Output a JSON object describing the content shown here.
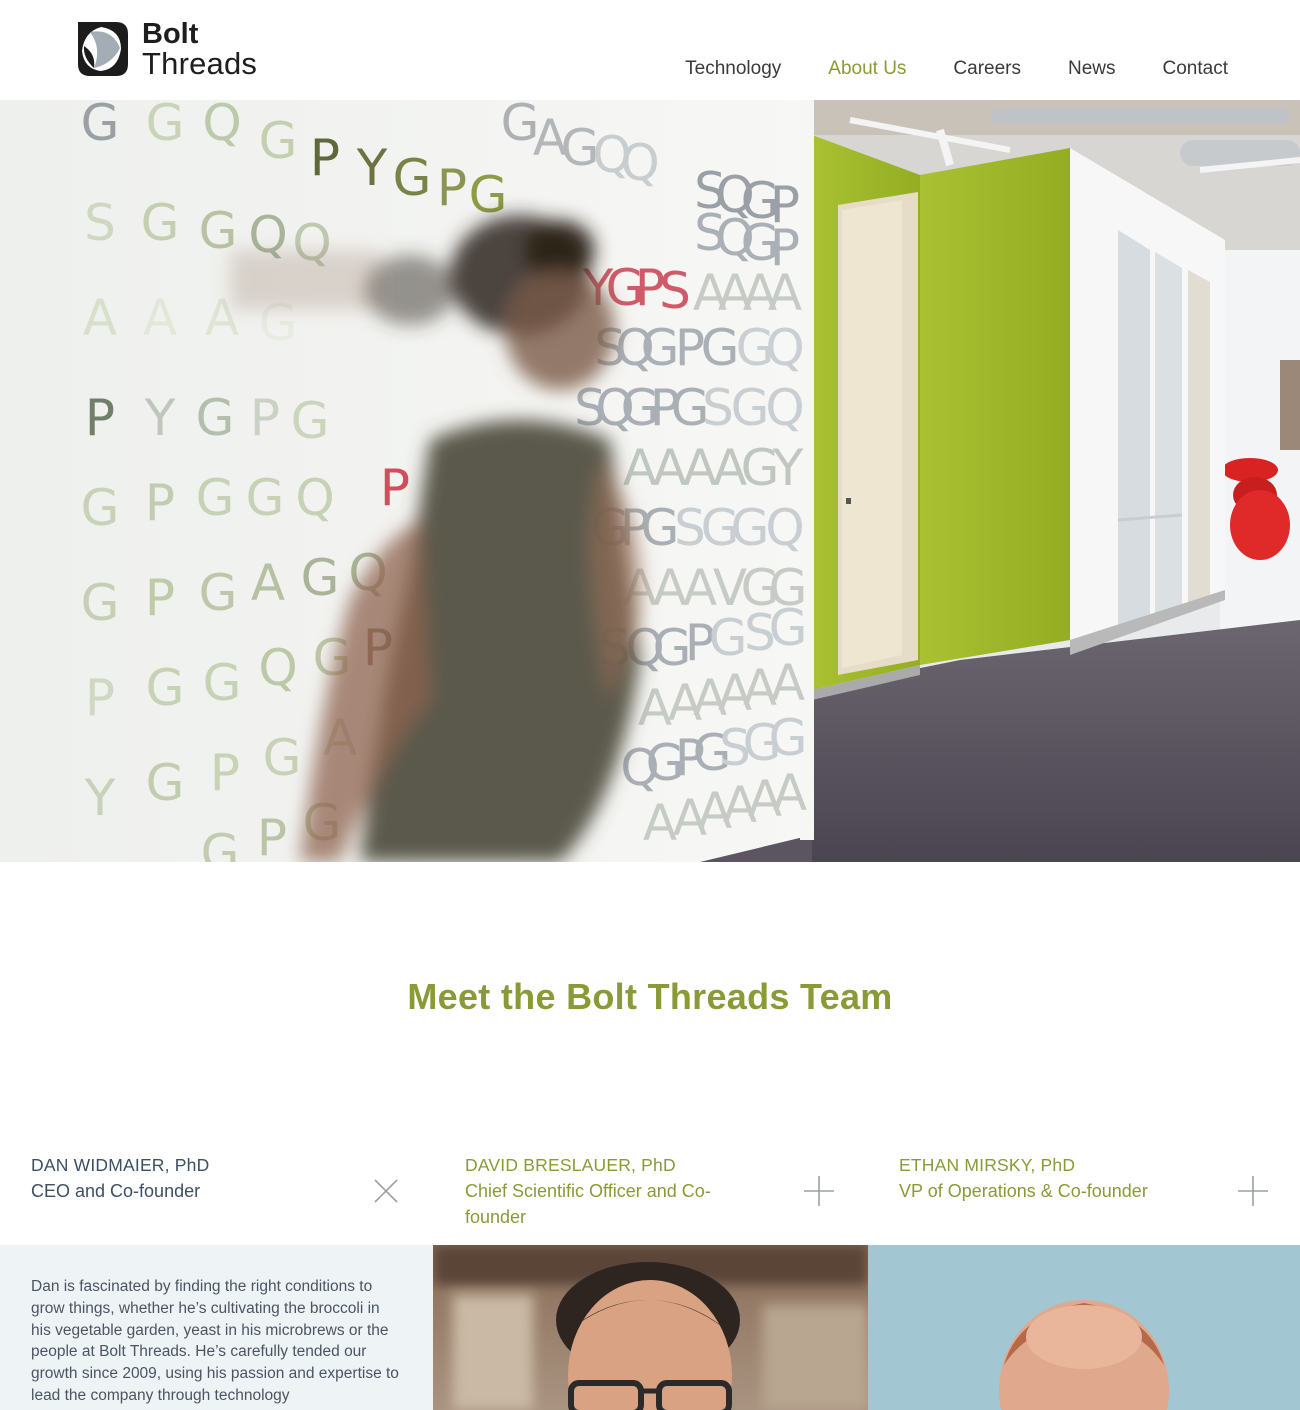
{
  "brand": {
    "name_line1": "Bolt",
    "name_line2": "Threads"
  },
  "nav": {
    "items": [
      {
        "label": "Technology",
        "active": false
      },
      {
        "label": "About Us",
        "active": true
      },
      {
        "label": "Careers",
        "active": false
      },
      {
        "label": "News",
        "active": false
      },
      {
        "label": "Contact",
        "active": false
      }
    ]
  },
  "hero": {
    "slide_count": 4,
    "active_slide": 2
  },
  "team": {
    "heading": "Meet the Bolt Threads Team",
    "members": [
      {
        "name": "DAN WIDMAIER, PhD",
        "role": "CEO and Co-founder",
        "expanded": true,
        "toggle_icon": "close-icon",
        "bio": "Dan is fascinated by finding the right conditions to grow things, whether he’s cultivating the broccoli in his vegetable garden, yeast in his microbrews or the people at Bolt Threads. He’s carefully tended our growth since 2009, using his passion and expertise to lead the company through technology"
      },
      {
        "name": "DAVID BRESLAUER, PhD",
        "role": "Chief Scientific Officer and Co-founder",
        "expanded": false,
        "toggle_icon": "plus-icon"
      },
      {
        "name": "ETHAN MIRSKY, PhD",
        "role": "VP of Operations & Co-founder",
        "expanded": false,
        "toggle_icon": "plus-icon"
      }
    ]
  },
  "colors": {
    "accent": "#8a9a36",
    "navy": "#3d4f63",
    "bio_bg": "#eef3f6",
    "wall_green": "#9cb52a"
  }
}
